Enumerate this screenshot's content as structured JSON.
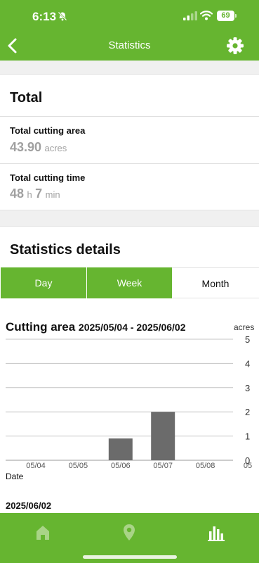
{
  "status_bar": {
    "time": "6:13",
    "battery": "69"
  },
  "nav": {
    "title": "Statistics"
  },
  "total": {
    "title": "Total",
    "area_label": "Total cutting area",
    "area_value": "43.90",
    "area_unit": "acres",
    "time_label": "Total cutting time",
    "time_hours": "48",
    "time_hours_unit": "h",
    "time_minutes": "7",
    "time_minutes_unit": "min"
  },
  "details": {
    "title": "Statistics details",
    "segments": {
      "day": "Day",
      "week": "Week",
      "month": "Month"
    },
    "selected_segment": "Month"
  },
  "chart_data": {
    "type": "bar",
    "title": "Cutting area",
    "date_range": "2025/05/04 - 2025/06/02",
    "ylabel": "acres",
    "xlabel": "Date",
    "categories": [
      "05/04",
      "05/05",
      "05/06",
      "05/07",
      "05/08",
      "05"
    ],
    "values": [
      0,
      0,
      0.9,
      2.0,
      0,
      0
    ],
    "yticks": [
      "5",
      "4",
      "3",
      "2",
      "1",
      "0"
    ],
    "ylim": [
      0,
      5
    ],
    "grid": true,
    "bar_color": "#6b6b6b"
  },
  "selected_date": "2025/06/02",
  "colors": {
    "accent": "#66b530"
  },
  "tab_bar": {
    "icons": [
      "home-icon",
      "location-pin-icon",
      "bar-chart-icon"
    ],
    "selected": "bar-chart-icon"
  }
}
